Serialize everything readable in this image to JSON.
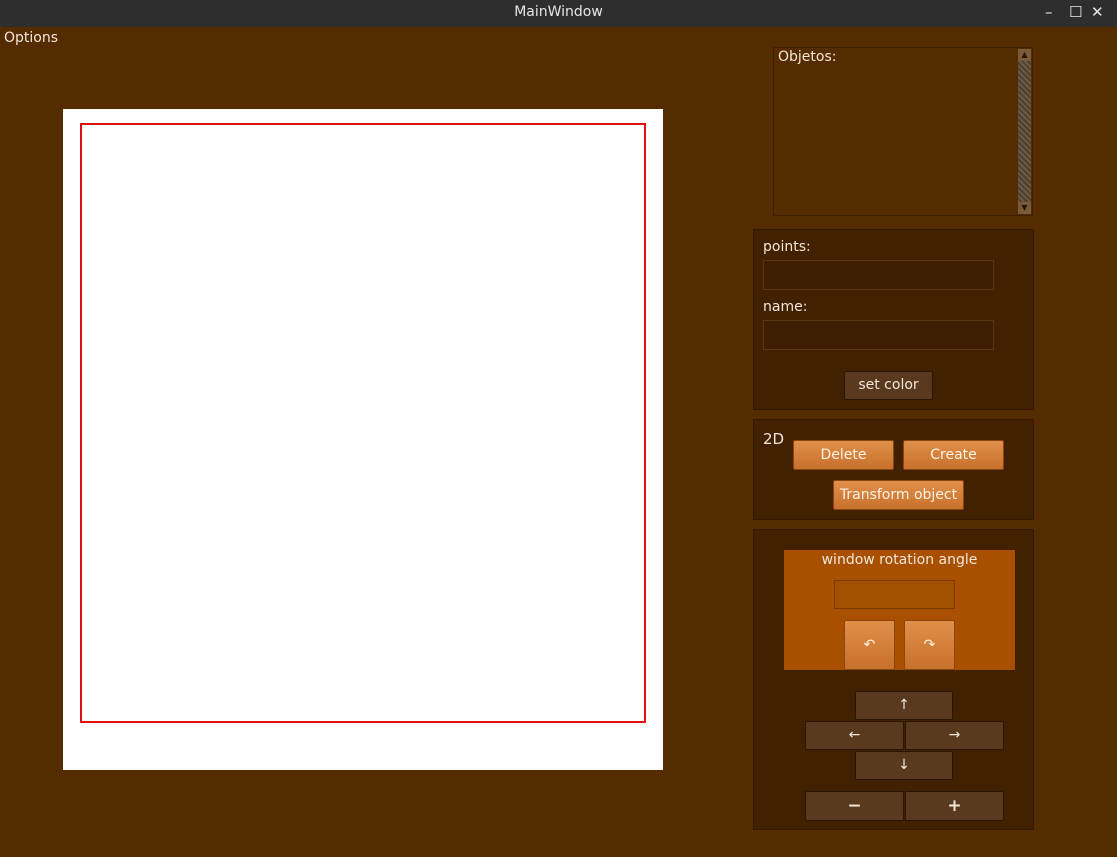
{
  "window": {
    "title": "MainWindow",
    "minimize_glyph": "–",
    "maximize_glyph": "☐",
    "close_glyph": "✕"
  },
  "menu": {
    "options_label": "Options"
  },
  "objects_panel": {
    "label": "Objetos:",
    "scroll_up_glyph": "▲",
    "scroll_down_glyph": "▼"
  },
  "form": {
    "points_label": "points:",
    "points_value": "",
    "name_label": "name:",
    "name_value": "",
    "set_color_label": "set color"
  },
  "actions": {
    "mode_label": "2D",
    "delete_label": "Delete",
    "create_label": "Create",
    "transform_label": "Transform object"
  },
  "rotation": {
    "label": "window rotation angle",
    "angle_value": "",
    "rotate_left_glyph": "↶",
    "rotate_right_glyph": "↷"
  },
  "navigation": {
    "up_glyph": "↑",
    "left_glyph": "←",
    "right_glyph": "→",
    "down_glyph": "↓",
    "zoom_out_glyph": "−",
    "zoom_in_glyph": "+"
  },
  "colors": {
    "background": "#552b00",
    "panel": "#422100",
    "accent_orange": "#d98540",
    "viewport_border": "#e01010"
  }
}
